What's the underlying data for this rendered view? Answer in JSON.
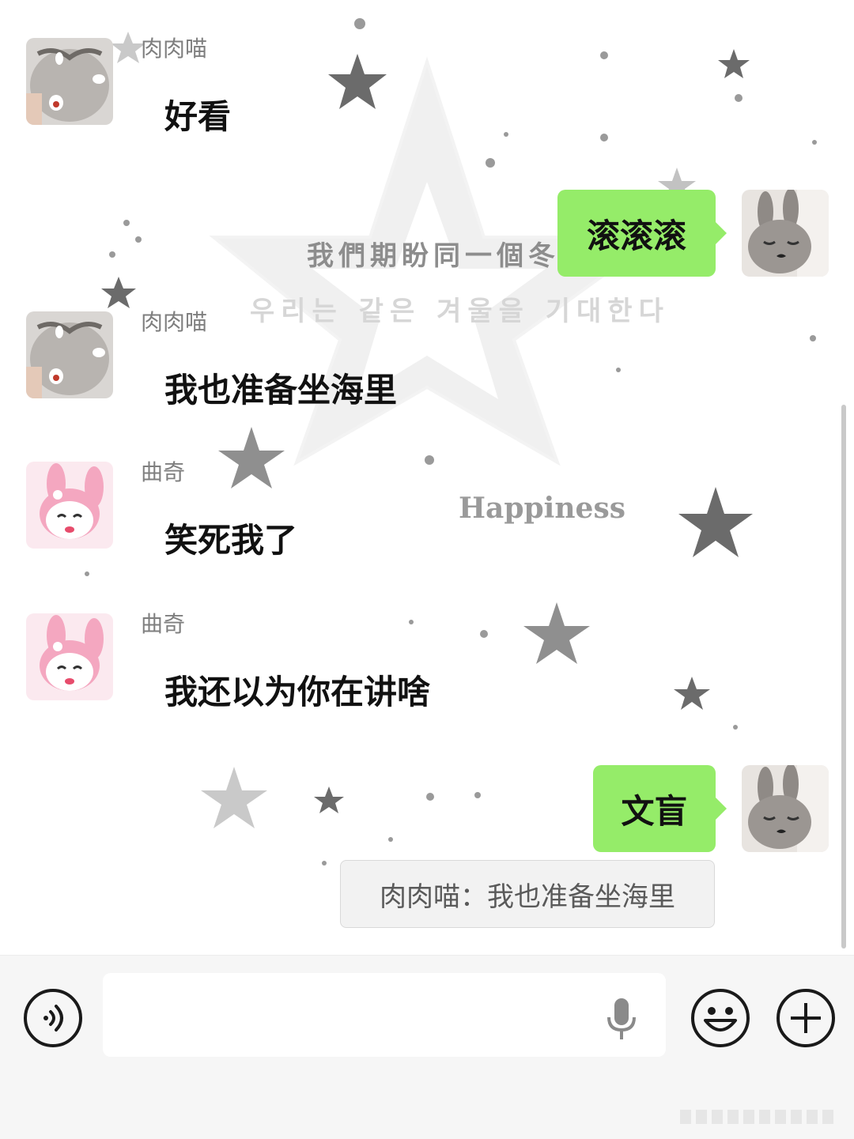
{
  "wallpaper": {
    "line1": "我們期盼同一個冬",
    "line2": "우리는 같은 겨울을 기대한다",
    "happiness": "Happiness"
  },
  "messages": [
    {
      "direction": "incoming",
      "sender": "肉肉喵",
      "text": "好看",
      "avatar": "kitten-avatar"
    },
    {
      "direction": "outgoing",
      "text": "滚滚滚",
      "avatar": "bunny-avatar"
    },
    {
      "direction": "incoming",
      "sender": "肉肉喵",
      "text": "我也准备坐海里",
      "avatar": "kitten-avatar"
    },
    {
      "direction": "incoming",
      "sender": "曲奇",
      "text": "笑死我了",
      "avatar": "my-melody-avatar"
    },
    {
      "direction": "incoming",
      "sender": "曲奇",
      "text": "我还以为你在讲啥",
      "avatar": "my-melody-avatar"
    },
    {
      "direction": "outgoing",
      "text": "文盲",
      "avatar": "bunny-avatar",
      "quote": "肉肉喵：我也准备坐海里"
    }
  ],
  "input_bar": {
    "text_value": "",
    "icons": [
      "voice-icon",
      "microphone-icon",
      "emoji-icon",
      "plus-icon"
    ]
  },
  "colors": {
    "outgoing_bubble": "#95ec69",
    "quote_bg": "#f2f2f2",
    "input_bar_bg": "#f6f6f6"
  }
}
